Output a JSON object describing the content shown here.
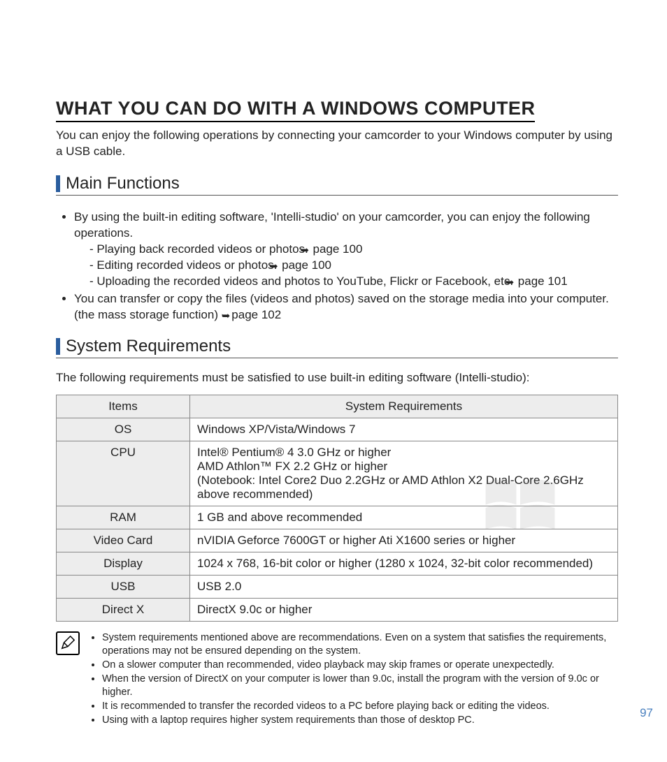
{
  "title": "WHAT YOU CAN DO WITH A WINDOWS COMPUTER",
  "intro": "You can enjoy the following operations by connecting your camcorder to your Windows computer by using a USB cable.",
  "pagenum": "97",
  "section1": {
    "heading": "Main Functions",
    "bullet1_lead": "By using the built-in editing software, 'Intelli-studio' on your camcorder, you can enjoy the following operations.",
    "sub1_a": "-   Playing back recorded videos or photos. ",
    "sub1_a_ref": "page 100",
    "sub1_b": "-   Editing recorded videos or photos. ",
    "sub1_b_ref": "page 100",
    "sub1_c": "-   Uploading the recorded videos and photos to YouTube, Flickr or Facebook, etc. ",
    "sub1_c_ref": "page 101",
    "bullet2_a": "You can transfer or copy the files (videos and photos) saved on the storage media into your computer. (the mass storage function) ",
    "bullet2_ref": "page 102"
  },
  "section2": {
    "heading": "System Requirements",
    "intro": "The following requirements must be satisfied to use built-in editing software (Intelli-studio):",
    "th1": "Items",
    "th2": "System Requirements",
    "rows": [
      {
        "k": "OS",
        "v": "Windows XP/Vista/Windows 7"
      },
      {
        "k": "CPU",
        "v": "Intel® Pentium® 4 3.0 GHz or higher\nAMD Athlon™ FX 2.2 GHz or higher\n(Notebook: Intel Core2 Duo 2.2GHz or AMD Athlon X2 Dual-Core 2.6GHz above recommended)"
      },
      {
        "k": "RAM",
        "v": "1 GB and above recommended"
      },
      {
        "k": "Video Card",
        "v": "nVIDIA Geforce 7600GT or higher Ati X1600 series or higher"
      },
      {
        "k": "Display",
        "v": "1024 x 768, 16-bit color or higher (1280 x 1024, 32-bit color recommended)"
      },
      {
        "k": "USB",
        "v": "USB 2.0"
      },
      {
        "k": "Direct X",
        "v": "DirectX 9.0c or higher"
      }
    ]
  },
  "notes": [
    "System requirements mentioned above are recommendations. Even on a system that satisfies the requirements, operations may not be ensured depending on the system.",
    "On a slower computer than recommended, video playback may skip frames or operate unexpectedly.",
    "When the version of DirectX on your computer is lower than 9.0c, install the program with the version of 9.0c or higher.",
    "It is recommended to transfer the recorded videos to a PC before playing back or editing the videos.",
    "Using with a laptop requires higher system requirements than those of desktop PC."
  ]
}
